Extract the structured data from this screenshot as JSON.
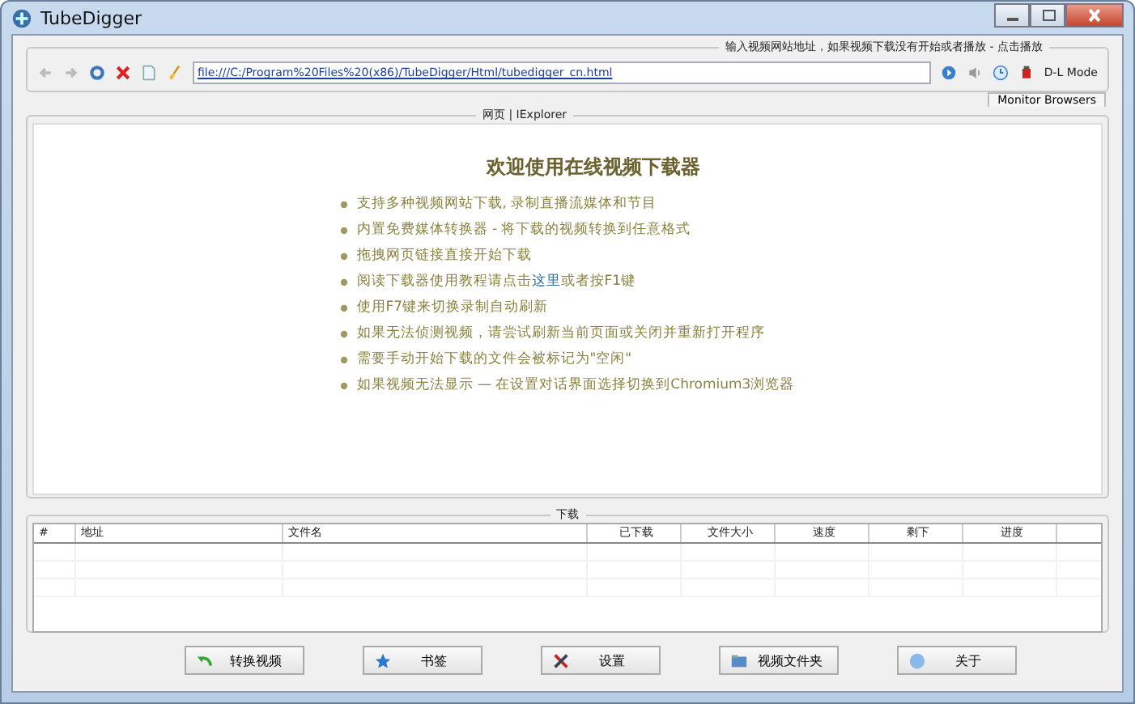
{
  "window": {
    "title": "TubeDigger"
  },
  "address_group": {
    "legend": "输入视频网站地址，如果视频下载没有开始或者播放 - 点击播放",
    "url": "file:///C:/Program%20Files%20(x86)/TubeDigger/Html/tubedigger_cn.html",
    "mode_label": "D-L Mode"
  },
  "monitor_tab": "Monitor Browsers",
  "browser_group": {
    "legend": "网页 | IExplorer",
    "heading": "欢迎使用在线视频下载器",
    "items": [
      {
        "text": "支持多种视频网站下载, 录制直播流媒体和节目"
      },
      {
        "text": "内置免费媒体转换器 - 将下载的视频转换到任意格式"
      },
      {
        "text": "拖拽网页链接直接开始下载"
      },
      {
        "text": "阅读下载器使用教程请点击",
        "link": "这里",
        "after": "或者按F1键"
      },
      {
        "text": "使用F7键来切换录制自动刷新"
      },
      {
        "text": "如果无法侦测视频，请尝试刷新当前页面或关闭并重新打开程序"
      },
      {
        "text": "需要手动开始下载的文件会被标记为\"空闲\""
      },
      {
        "text": "如果视频无法显示 — 在设置对话界面选择切换到Chromium3浏览器"
      }
    ]
  },
  "downloads": {
    "legend": "下载",
    "columns": [
      "#",
      "地址",
      "文件名",
      "已下载",
      "文件大小",
      "速度",
      "剩下",
      "进度"
    ]
  },
  "buttons": [
    {
      "label": "转换视频",
      "kind": "convert"
    },
    {
      "label": "书签",
      "kind": "bookmark"
    },
    {
      "label": "设置",
      "kind": "settings"
    },
    {
      "label": "视频文件夹",
      "kind": "folder"
    },
    {
      "label": "关于",
      "kind": "about"
    }
  ]
}
